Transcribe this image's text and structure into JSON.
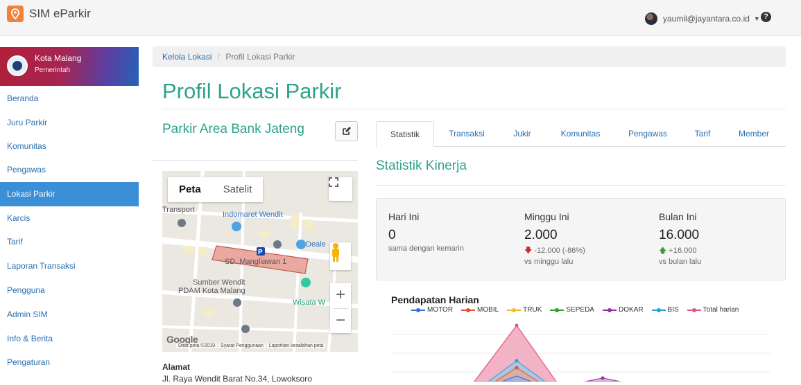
{
  "app": {
    "title": "SIM eParkir"
  },
  "user": {
    "email": "yaumil@jayantara.co.id"
  },
  "org": {
    "name": "Kota Malang",
    "type": "Pemerintah"
  },
  "sidebar": {
    "items": [
      {
        "label": "Beranda"
      },
      {
        "label": "Juru Parkir"
      },
      {
        "label": "Komunitas"
      },
      {
        "label": "Pengawas"
      },
      {
        "label": "Lokasi Parkir",
        "active": true
      },
      {
        "label": "Karcis"
      },
      {
        "label": "Tarif"
      },
      {
        "label": "Laporan Transaksi"
      },
      {
        "label": "Pengguna"
      },
      {
        "label": "Admin SIM"
      },
      {
        "label": "Info & Berita"
      },
      {
        "label": "Pengaturan"
      }
    ]
  },
  "breadcrumb": {
    "parent": "Kelola Lokasi",
    "separator": "/",
    "current": "Profil Lokasi Parkir"
  },
  "page": {
    "title": "Profil Lokasi Parkir"
  },
  "location": {
    "name": "Parkir Area Bank Jateng",
    "address_label": "Alamat",
    "address": "Jl. Raya Wendit Barat No.34, Lowoksoro"
  },
  "map": {
    "toggle_map": "Peta",
    "toggle_satellite": "Satelit",
    "google": "Google",
    "data_credit": "Data peta ©2019",
    "terms": "Syarat Penggunaan",
    "report": "Laporkan kesalahan peta",
    "labels": {
      "transport": "Transport",
      "indomaret": "Indomaret Wendit",
      "dealer": "Deale",
      "sd": "SD. Mangliawan 1",
      "sumber_1": "Sumber Wendit",
      "sumber_2": "PDAM Kota Malang",
      "wisata": "Wisata W",
      "parking": "P"
    }
  },
  "tabs": [
    {
      "label": "Statistik",
      "active": true
    },
    {
      "label": "Transaksi"
    },
    {
      "label": "Jukir"
    },
    {
      "label": "Komunitas"
    },
    {
      "label": "Pengawas"
    },
    {
      "label": "Tarif"
    },
    {
      "label": "Member"
    }
  ],
  "stats": {
    "title": "Statistik Kinerja",
    "today": {
      "label": "Hari Ini",
      "value": "0",
      "sub": "sama dengan kemarin"
    },
    "week": {
      "label": "Minggu Ini",
      "value": "2.000",
      "change": "-12.000 (-86%)",
      "sub": "vs minggu lalu"
    },
    "month": {
      "label": "Bulan Ini",
      "value": "16.000",
      "change": "+16.000",
      "sub": "vs bulan lalu"
    }
  },
  "colors": {
    "accent": "#2ba38d",
    "link": "#2a6fb0",
    "active": "#3b8fd6"
  },
  "chart_data": {
    "type": "area",
    "title": "Pendapatan Harian",
    "series": [
      {
        "name": "MOTOR",
        "color": "#3b6fd6"
      },
      {
        "name": "MOBIL",
        "color": "#e2512d"
      },
      {
        "name": "TRUK",
        "color": "#f3b92b"
      },
      {
        "name": "SEPEDA",
        "color": "#2ca02c"
      },
      {
        "name": "DOKAR",
        "color": "#9b2ca0"
      },
      {
        "name": "BIS",
        "color": "#21a1d6"
      },
      {
        "name": "Total harian",
        "color": "#e0557a"
      }
    ]
  }
}
